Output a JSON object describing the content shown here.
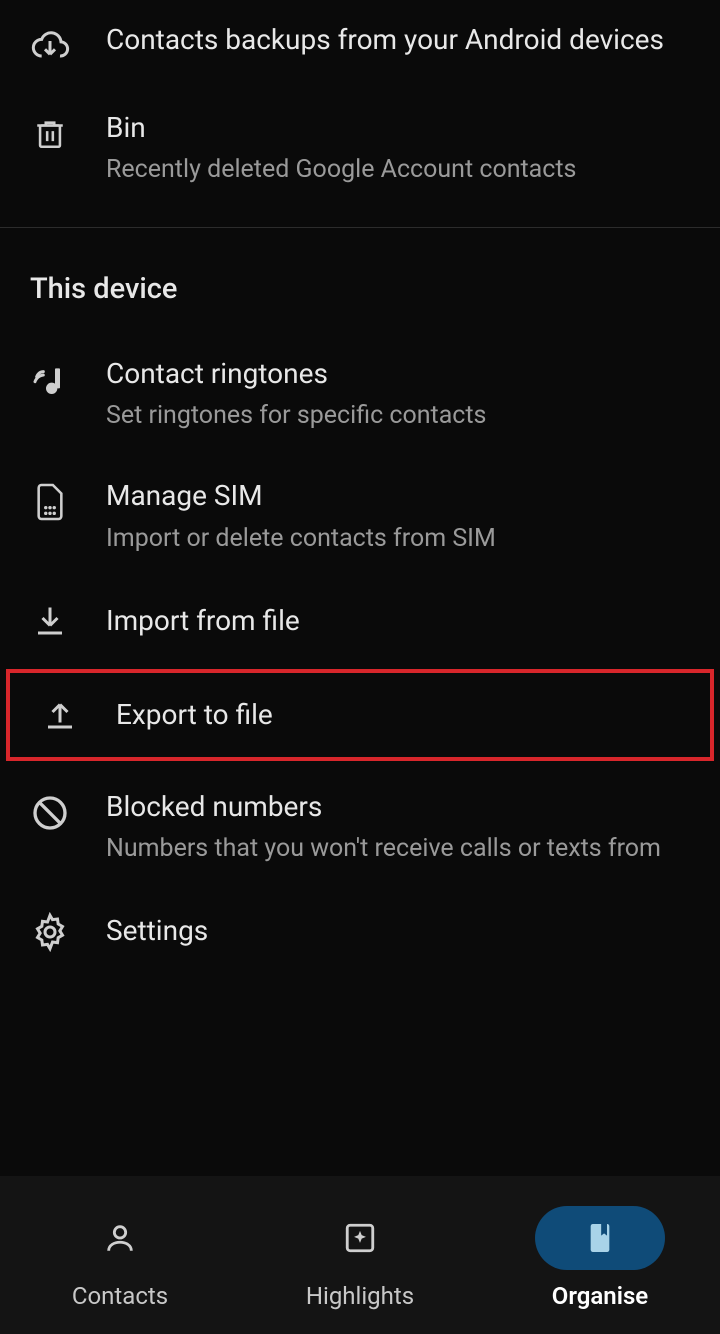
{
  "sections": {
    "cloud": [
      {
        "icon": "cloud-download",
        "title": "Contacts backups from your Android devices",
        "subtitle": ""
      },
      {
        "icon": "trash",
        "title": "Bin",
        "subtitle": "Recently deleted Google Account contacts"
      }
    ],
    "device_header": "This device",
    "device": [
      {
        "icon": "music-note",
        "title": "Contact ringtones",
        "subtitle": "Set ringtones for specific contacts"
      },
      {
        "icon": "sim",
        "title": "Manage SIM",
        "subtitle": "Import or delete contacts from SIM"
      },
      {
        "icon": "download-arrow",
        "title": "Import from file",
        "subtitle": ""
      },
      {
        "icon": "upload-arrow",
        "title": "Export to file",
        "subtitle": ""
      },
      {
        "icon": "block",
        "title": "Blocked numbers",
        "subtitle": "Numbers that you won't receive calls or texts from"
      },
      {
        "icon": "gear",
        "title": "Settings",
        "subtitle": ""
      }
    ]
  },
  "nav": [
    {
      "icon": "person",
      "label": "Contacts",
      "active": false
    },
    {
      "icon": "sparkle-box",
      "label": "Highlights",
      "active": false
    },
    {
      "icon": "bookmark",
      "label": "Organise",
      "active": true
    }
  ],
  "highlighted_item": "Export to file"
}
